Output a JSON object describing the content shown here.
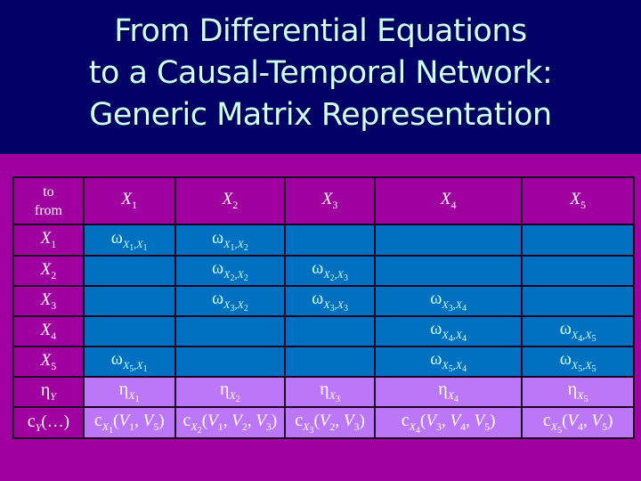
{
  "title": {
    "lines": [
      "From Differential Equations",
      "to a Causal-Temporal Network:",
      "Generic Matrix Representation"
    ]
  },
  "colors": {
    "title_background": "#000066",
    "title_text": "#ccffff",
    "slide_background": "#a000a0",
    "omega_cells": "#0070c0",
    "eta_cells": "#bb77f7"
  },
  "matrix": {
    "corner": {
      "top": "to",
      "bottom": "from"
    },
    "columns": [
      {
        "var": "X",
        "sub": "1"
      },
      {
        "var": "X",
        "sub": "2"
      },
      {
        "var": "X",
        "sub": "3"
      },
      {
        "var": "X",
        "sub": "4"
      },
      {
        "var": "X",
        "sub": "5"
      }
    ],
    "rows": [
      {
        "label_var": "X",
        "label_sub": "1",
        "cells": [
          {
            "sym": "ω",
            "s1": "X",
            "n1": "1",
            "s2": "X",
            "n2": "1"
          },
          {
            "sym": "ω",
            "s1": "X",
            "n1": "1",
            "s2": "X",
            "n2": "2"
          },
          null,
          null,
          null
        ]
      },
      {
        "label_var": "X",
        "label_sub": "2",
        "cells": [
          null,
          {
            "sym": "ω",
            "s1": "X",
            "n1": "2",
            "s2": "X",
            "n2": "2"
          },
          {
            "sym": "ω",
            "s1": "X",
            "n1": "2",
            "s2": "X",
            "n2": "3"
          },
          null,
          null
        ]
      },
      {
        "label_var": "X",
        "label_sub": "3",
        "cells": [
          null,
          {
            "sym": "ω",
            "s1": "X",
            "n1": "3",
            "s2": "X",
            "n2": "2"
          },
          {
            "sym": "ω",
            "s1": "X",
            "n1": "3",
            "s2": "X",
            "n2": "3"
          },
          {
            "sym": "ω",
            "s1": "X",
            "n1": "3",
            "s2": "X",
            "n2": "4"
          },
          null
        ]
      },
      {
        "label_var": "X",
        "label_sub": "4",
        "cells": [
          null,
          null,
          null,
          {
            "sym": "ω",
            "s1": "X",
            "n1": "4",
            "s2": "X",
            "n2": "4"
          },
          {
            "sym": "ω",
            "s1": "X",
            "n1": "4",
            "s2": "X",
            "n2": "5"
          }
        ]
      },
      {
        "label_var": "X",
        "label_sub": "5",
        "cells": [
          {
            "sym": "ω",
            "s1": "X",
            "n1": "5",
            "s2": "X",
            "n2": "1"
          },
          null,
          null,
          {
            "sym": "ω",
            "s1": "X",
            "n1": "5",
            "s2": "X",
            "n2": "4"
          },
          {
            "sym": "ω",
            "s1": "X",
            "n1": "5",
            "s2": "X",
            "n2": "5"
          }
        ]
      }
    ],
    "eta_row": {
      "label_sym": "η",
      "label_sub": "Y",
      "cells": [
        {
          "sym": "η",
          "s": "X",
          "n": "1"
        },
        {
          "sym": "η",
          "s": "X",
          "n": "2"
        },
        {
          "sym": "η",
          "s": "X",
          "n": "3"
        },
        {
          "sym": "η",
          "s": "X",
          "n": "4"
        },
        {
          "sym": "η",
          "s": "X",
          "n": "5"
        }
      ]
    },
    "c_row": {
      "label": {
        "sym": "c",
        "sub": "Y",
        "args": "(…)"
      },
      "cells": [
        {
          "sym": "c",
          "s": "X",
          "n": "1",
          "args": [
            {
              "v": "V",
              "n": "1"
            },
            {
              "v": "V",
              "n": "5"
            }
          ]
        },
        {
          "sym": "c",
          "s": "X",
          "n": "2",
          "args": [
            {
              "v": "V",
              "n": "1"
            },
            {
              "v": "V",
              "n": "2"
            },
            {
              "v": "V",
              "n": "3"
            }
          ]
        },
        {
          "sym": "c",
          "s": "X",
          "n": "3",
          "args": [
            {
              "v": "V",
              "n": "2"
            },
            {
              "v": "V",
              "n": "3"
            }
          ]
        },
        {
          "sym": "c",
          "s": "X",
          "n": "4",
          "args": [
            {
              "v": "V",
              "n": "3"
            },
            {
              "v": "V",
              "n": "4"
            },
            {
              "v": "V",
              "n": "5"
            }
          ]
        },
        {
          "sym": "c",
          "s": "X",
          "n": "5",
          "args": [
            {
              "v": "V",
              "n": "4"
            },
            {
              "v": "V",
              "n": "5"
            }
          ]
        }
      ]
    }
  }
}
